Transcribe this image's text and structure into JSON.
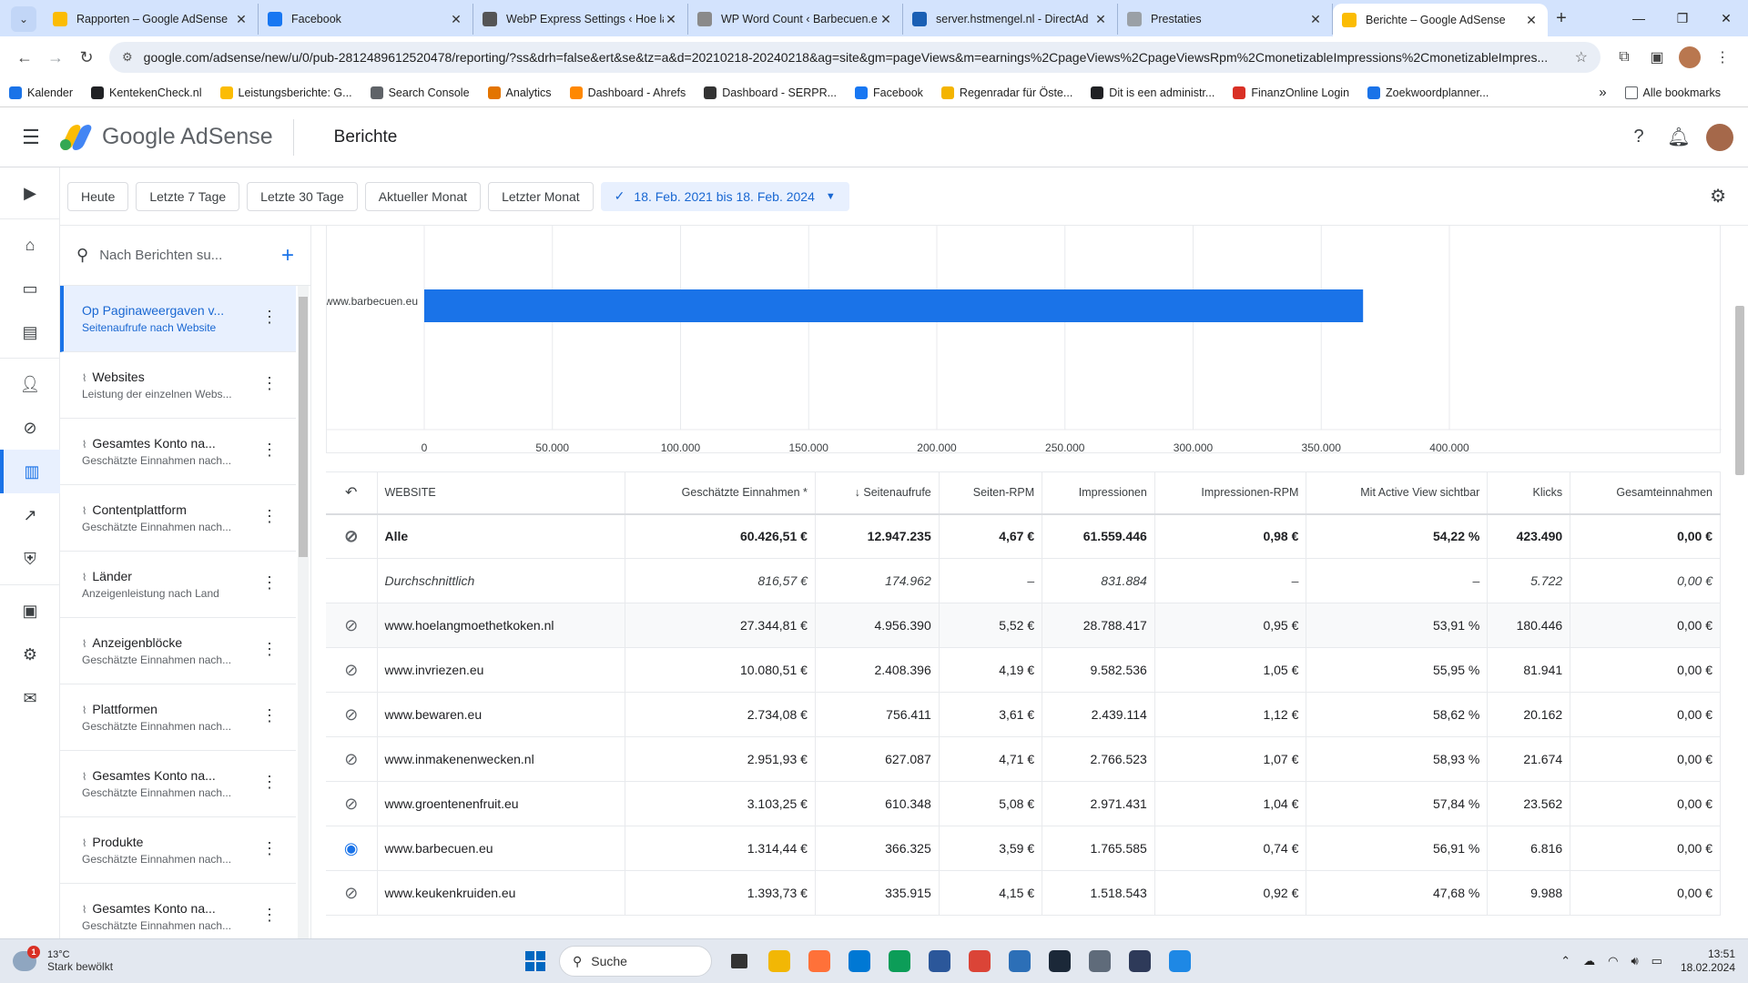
{
  "browser": {
    "tabs": [
      {
        "title": "Rapporten – Google AdSense",
        "icon": "adsense-icon",
        "color": "#fbbc04"
      },
      {
        "title": "Facebook",
        "icon": "facebook-icon",
        "color": "#1877f2"
      },
      {
        "title": "WebP Express Settings ‹ Hoe la",
        "icon": "wordpress-icon",
        "color": "#555555"
      },
      {
        "title": "WP Word Count ‹ Barbecuen.e",
        "icon": "plugin-icon",
        "color": "#8a8a8a"
      },
      {
        "title": "server.hstmengel.nl - DirectAd",
        "icon": "directadmin-icon",
        "color": "#1a5fb4"
      },
      {
        "title": "Prestaties",
        "icon": "document-icon",
        "color": "#9aa0a6"
      },
      {
        "title": "Berichte – Google AdSense",
        "icon": "adsense-icon",
        "color": "#fbbc04",
        "active": true
      }
    ],
    "url": "google.com/adsense/new/u/0/pub-2812489612520478/reporting/?ss&drh=false&ert&se&tz=a&d=20210218-20240218&ag=site&gm=pageViews&m=earnings%2CpageViews%2CpageViewsRpm%2CmonetizableImpressions%2CmonetizableImpres...",
    "bookmarks": [
      {
        "label": "Kalender",
        "color": "#1a73e8"
      },
      {
        "label": "KentekenCheck.nl",
        "color": "#202124"
      },
      {
        "label": "Leistungsberichte: G...",
        "color": "#fbbc04"
      },
      {
        "label": "Search Console",
        "color": "#5f6368"
      },
      {
        "label": "Analytics",
        "color": "#e37400"
      },
      {
        "label": "Dashboard - Ahrefs",
        "color": "#ff8800"
      },
      {
        "label": "Dashboard - SERPR...",
        "color": "#333333"
      },
      {
        "label": "Facebook",
        "color": "#1877f2"
      },
      {
        "label": "Regenradar für Öste...",
        "color": "#f4b400"
      },
      {
        "label": "Dit is een administr...",
        "color": "#202124"
      },
      {
        "label": "FinanzOnline Login",
        "color": "#d93025"
      },
      {
        "label": "Zoekwoordplanner...",
        "color": "#1a73e8"
      }
    ],
    "all_bookmarks": "Alle bookmarks"
  },
  "header": {
    "brand": "Google AdSense",
    "page_title": "Berichte"
  },
  "filters": {
    "chips": [
      "Heute",
      "Letzte 7 Tage",
      "Letzte 30 Tage",
      "Aktueller Monat",
      "Letzter Monat"
    ],
    "selected_range": "18. Feb. 2021 bis 18. Feb. 2024"
  },
  "sidebar": {
    "search_placeholder": "Nach Berichten su...",
    "items": [
      {
        "title": "Op Paginaweergaven v...",
        "subtitle": "Seitenaufrufe nach Website",
        "active": true
      },
      {
        "title": "Websites",
        "subtitle": "Leistung der einzelnen Webs..."
      },
      {
        "title": "Gesamtes Konto na...",
        "subtitle": "Geschätzte Einnahmen nach..."
      },
      {
        "title": "Contentplattform",
        "subtitle": "Geschätzte Einnahmen nach..."
      },
      {
        "title": "Länder",
        "subtitle": "Anzeigenleistung nach Land"
      },
      {
        "title": "Anzeigenblöcke",
        "subtitle": "Geschätzte Einnahmen nach..."
      },
      {
        "title": "Plattformen",
        "subtitle": "Geschätzte Einnahmen nach..."
      },
      {
        "title": "Gesamtes Konto na...",
        "subtitle": "Geschätzte Einnahmen nach..."
      },
      {
        "title": "Produkte",
        "subtitle": "Geschätzte Einnahmen nach..."
      },
      {
        "title": "Gesamtes Konto na...",
        "subtitle": "Geschätzte Einnahmen nach..."
      }
    ]
  },
  "chart_data": {
    "type": "bar",
    "orientation": "horizontal",
    "categories": [
      "www.barbecuen.eu"
    ],
    "values": [
      366325
    ],
    "xlim": [
      0,
      400000
    ],
    "ticks": [
      "0",
      "50.000",
      "100.000",
      "150.000",
      "200.000",
      "250.000",
      "300.000",
      "350.000",
      "400.000"
    ],
    "tick_values": [
      0,
      50000,
      100000,
      150000,
      200000,
      250000,
      300000,
      350000,
      400000
    ],
    "color": "#1a73e8",
    "grid": true
  },
  "table": {
    "columns": [
      "WEBSITE",
      "Geschätzte Einnahmen *",
      "Seitenaufrufe",
      "Seiten-RPM",
      "Impressionen",
      "Impressionen-RPM",
      "Mit Active View sichtbar",
      "Klicks",
      "Gesamteinnahmen"
    ],
    "total": {
      "site": "Alle",
      "cells": [
        "60.426,51 €",
        "12.947.235",
        "4,67 €",
        "61.559.446",
        "0,98 €",
        "54,22 %",
        "423.490",
        "0,00 €"
      ]
    },
    "average": {
      "site": "Durchschnittlich",
      "cells": [
        "816,57 €",
        "174.962",
        "–",
        "831.884",
        "–",
        "–",
        "5.722",
        "0,00 €"
      ]
    },
    "rows": [
      {
        "site": "www.hoelangmoethetkoken.nl",
        "visible": false,
        "cells": [
          "27.344,81 €",
          "4.956.390",
          "5,52 €",
          "28.788.417",
          "0,95 €",
          "53,91 %",
          "180.446",
          "0,00 €"
        ]
      },
      {
        "site": "www.invriezen.eu",
        "visible": false,
        "cells": [
          "10.080,51 €",
          "2.408.396",
          "4,19 €",
          "9.582.536",
          "1,05 €",
          "55,95 %",
          "81.941",
          "0,00 €"
        ]
      },
      {
        "site": "www.bewaren.eu",
        "visible": false,
        "cells": [
          "2.734,08 €",
          "756.411",
          "3,61 €",
          "2.439.114",
          "1,12 €",
          "58,62 %",
          "20.162",
          "0,00 €"
        ]
      },
      {
        "site": "www.inmakenenwecken.nl",
        "visible": false,
        "cells": [
          "2.951,93 €",
          "627.087",
          "4,71 €",
          "2.766.523",
          "1,07 €",
          "58,93 %",
          "21.674",
          "0,00 €"
        ]
      },
      {
        "site": "www.groentenenfruit.eu",
        "visible": false,
        "cells": [
          "3.103,25 €",
          "610.348",
          "5,08 €",
          "2.971.431",
          "1,04 €",
          "57,84 %",
          "23.562",
          "0,00 €"
        ]
      },
      {
        "site": "www.barbecuen.eu",
        "visible": true,
        "cells": [
          "1.314,44 €",
          "366.325",
          "3,59 €",
          "1.765.585",
          "0,74 €",
          "56,91 %",
          "6.816",
          "0,00 €"
        ]
      },
      {
        "site": "www.keukenkruiden.eu",
        "visible": false,
        "cells": [
          "1.393,73 €",
          "335.915",
          "4,15 €",
          "1.518.543",
          "0,92 €",
          "47,68 %",
          "9.988",
          "0,00 €"
        ]
      }
    ]
  },
  "taskbar": {
    "weather_temp": "13°C",
    "weather_desc": "Stark bewölkt",
    "weather_badge": "1",
    "search": "Suche",
    "time": "13:51",
    "date": "18.02.2024",
    "apps": [
      {
        "name": "file-explorer",
        "color": "#f2b705"
      },
      {
        "name": "firefox",
        "color": "#ff7139"
      },
      {
        "name": "outlook",
        "color": "#0078d4"
      },
      {
        "name": "edge",
        "color": "#0c9d58"
      },
      {
        "name": "word",
        "color": "#2b579a"
      },
      {
        "name": "chrome",
        "color": "#db4437"
      },
      {
        "name": "app-blue",
        "color": "#2c6fb7"
      },
      {
        "name": "steam",
        "color": "#1b2838"
      },
      {
        "name": "calculator",
        "color": "#5f6b7a"
      },
      {
        "name": "app-dark",
        "color": "#2e3a59"
      },
      {
        "name": "notepad",
        "color": "#1e88e5"
      }
    ]
  }
}
